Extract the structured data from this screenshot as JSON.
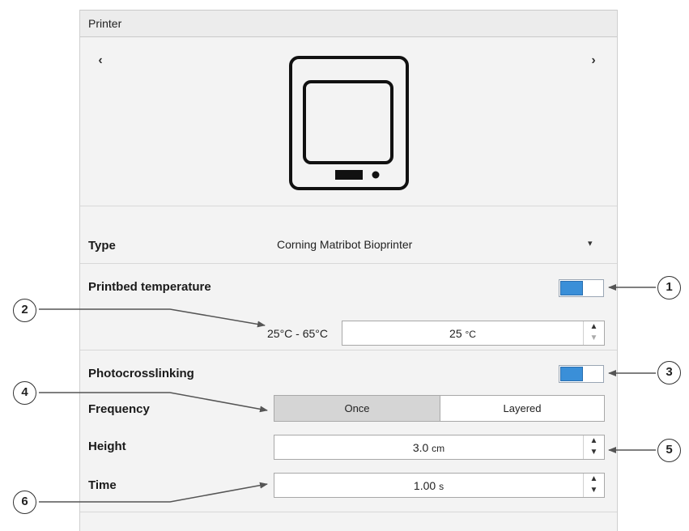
{
  "panel": {
    "title": "Printer",
    "prev_label": "‹",
    "next_label": "›",
    "icon": "printer-icon"
  },
  "type_row": {
    "label": "Type",
    "value": "Corning Matribot Bioprinter",
    "dropdown_icon": "▾"
  },
  "printbed": {
    "label": "Printbed temperature",
    "toggle_on": true,
    "range": "25°C - 65°C",
    "value": "25",
    "unit": "°C",
    "up": "▲",
    "down": "▼"
  },
  "photocrosslinking": {
    "label": "Photocrosslinking",
    "toggle_on": true
  },
  "frequency": {
    "label": "Frequency",
    "options": [
      "Once",
      "Layered"
    ],
    "selected": "Once"
  },
  "height": {
    "label": "Height",
    "value": "3.0",
    "unit": "cm",
    "up": "▲",
    "down": "▼"
  },
  "time": {
    "label": "Time",
    "value": "1.00",
    "unit": "s",
    "up": "▲",
    "down": "▼"
  },
  "callouts": [
    "1",
    "2",
    "3",
    "4",
    "5",
    "6"
  ],
  "colors": {
    "toggle_on": "#3a8fd8",
    "panel_bg": "#f3f3f3",
    "selected_segment": "#d5d5d5"
  }
}
